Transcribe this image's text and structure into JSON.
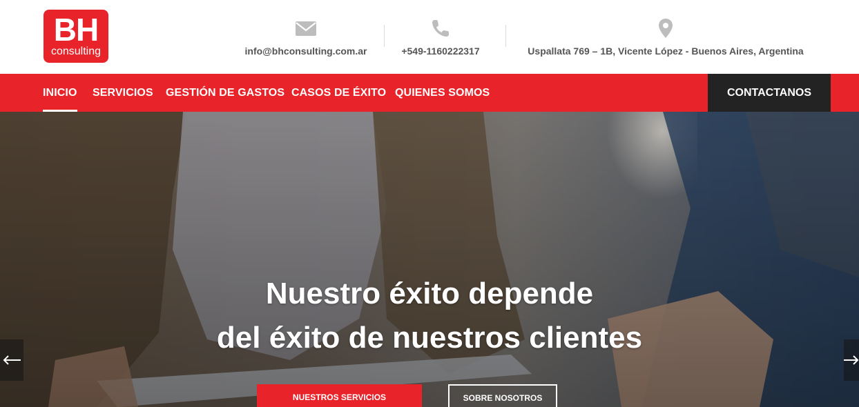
{
  "brand": {
    "logo_main": "BH",
    "logo_sub": "consulting",
    "color": "#e8232a"
  },
  "contact": {
    "email": "info@bhconsulting.com.ar",
    "phone": "+549-1160222317",
    "address": "Uspallata 769 – 1B, Vicente López - Buenos Aires, Argentina"
  },
  "nav": {
    "items": [
      {
        "label": "INICIO",
        "active": true
      },
      {
        "label": "SERVICIOS",
        "active": false
      },
      {
        "label": "GESTIÓN DE GASTOS",
        "active": false
      },
      {
        "label": "CASOS DE ÉXITO",
        "active": false
      },
      {
        "label": "QUIENES SOMOS",
        "active": false
      }
    ],
    "cta": "CONTACTANOS"
  },
  "hero": {
    "line1": "Nuestro éxito depende",
    "line2": "del éxito de nuestros clientes",
    "primary_button": "NUESTROS SERVICIOS",
    "secondary_button": "SOBRE NOSOTROS"
  },
  "icons": {
    "email": "envelope-icon",
    "phone": "phone-icon",
    "address": "map-pin-icon",
    "prev": "arrow-left-icon",
    "next": "arrow-right-icon"
  },
  "colors": {
    "accent": "#e8232a",
    "dark": "#232323",
    "muted_text": "#555555",
    "icon_gray": "#bdbdbd"
  }
}
